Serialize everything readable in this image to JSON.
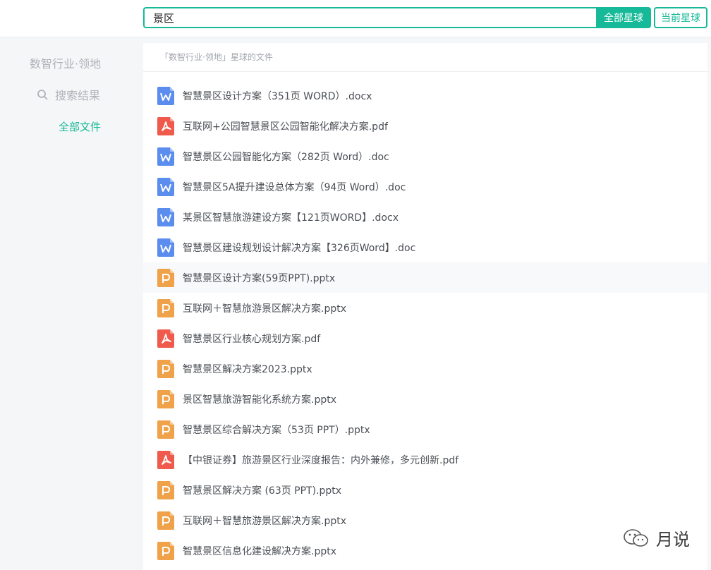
{
  "search": {
    "query": "景区",
    "all_button": "全部星球",
    "current_button": "当前星球"
  },
  "sidebar": {
    "title": "数智行业·领地",
    "search_results": "搜索结果",
    "all_files": "全部文件"
  },
  "main": {
    "header": "「数智行业·领地」星球的文件"
  },
  "files": [
    {
      "name": "智慧景区设计方案（351页 WORD）.docx",
      "type": "word"
    },
    {
      "name": "互联网+公园智慧景区公园智能化解决方案.pdf",
      "type": "pdf"
    },
    {
      "name": "智慧景区公园智能化方案（282页 Word）.doc",
      "type": "word"
    },
    {
      "name": "智慧景区5A提升建设总体方案（94页 Word）.doc",
      "type": "word"
    },
    {
      "name": "某景区智慧旅游建设方案【121页WORD】.docx",
      "type": "word"
    },
    {
      "name": "智慧景区建设规划设计解决方案【326页Word】.doc",
      "type": "word"
    },
    {
      "name": "智慧景区设计方案(59页PPT).pptx",
      "type": "ppt"
    },
    {
      "name": "互联网＋智慧旅游景区解决方案.pptx",
      "type": "ppt"
    },
    {
      "name": "智慧景区行业核心规划方案.pdf",
      "type": "pdf"
    },
    {
      "name": "智慧景区解决方案2023.pptx",
      "type": "ppt"
    },
    {
      "name": "景区智慧旅游智能化系统方案.pptx",
      "type": "ppt"
    },
    {
      "name": "智慧景区综合解决方案（53页 PPT）.pptx",
      "type": "ppt"
    },
    {
      "name": "【中银证券】旅游景区行业深度报告：内外兼修，多元创新.pdf",
      "type": "pdf"
    },
    {
      "name": "智慧景区解决方案 (63页 PPT).pptx",
      "type": "ppt"
    },
    {
      "name": "互联网＋智慧旅游景区解决方案.pptx",
      "type": "ppt"
    },
    {
      "name": "智慧景区信息化建设解决方案.pptx",
      "type": "ppt"
    }
  ],
  "watermark": {
    "text": "月说"
  },
  "colors": {
    "accent": "#16b998",
    "word": "#5b8def",
    "pdf": "#ef5a4c",
    "ppt": "#f0a24a"
  }
}
